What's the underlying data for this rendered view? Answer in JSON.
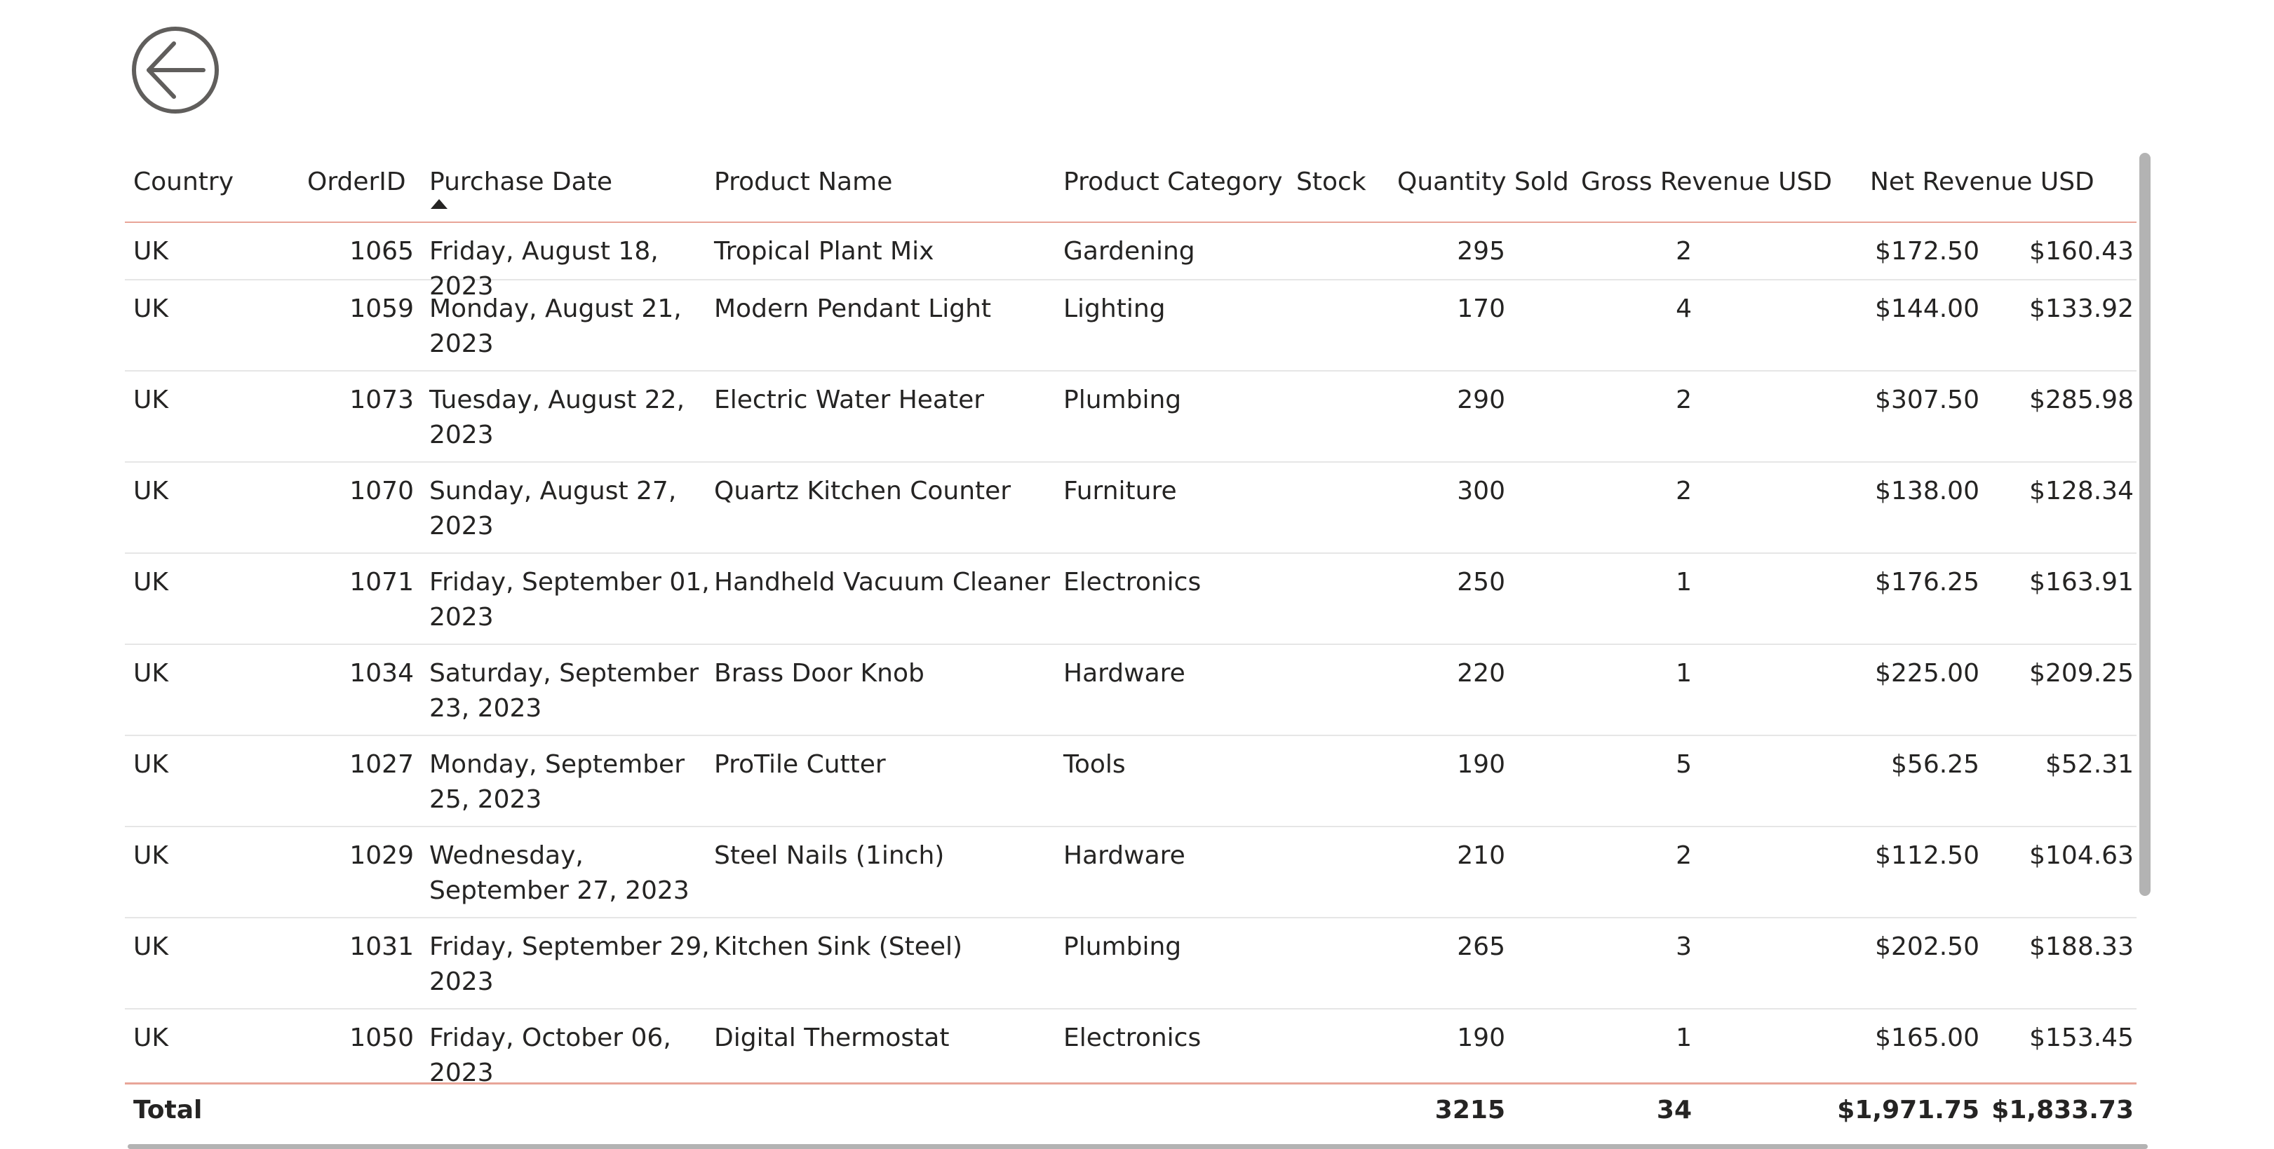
{
  "back_button": {
    "icon": "arrow-left-circle-icon"
  },
  "table": {
    "columns": [
      "Country",
      "OrderID",
      "Purchase Date",
      "Product Name",
      "Product Category",
      "Stock",
      "Quantity Sold",
      "Gross Revenue USD",
      "Net Revenue USD"
    ],
    "sorted_column": "Purchase Date",
    "sort_direction": "ascending",
    "rows": [
      [
        "UK",
        "1065",
        "Friday, August 18, 2023",
        "Tropical Plant Mix",
        "Gardening",
        "295",
        "2",
        "$172.50",
        "$160.43"
      ],
      [
        "UK",
        "1059",
        "Monday, August 21, 2023",
        "Modern Pendant Light",
        "Lighting",
        "170",
        "4",
        "$144.00",
        "$133.92"
      ],
      [
        "UK",
        "1073",
        "Tuesday, August 22, 2023",
        "Electric Water Heater",
        "Plumbing",
        "290",
        "2",
        "$307.50",
        "$285.98"
      ],
      [
        "UK",
        "1070",
        "Sunday, August 27, 2023",
        "Quartz Kitchen Counter",
        "Furniture",
        "300",
        "2",
        "$138.00",
        "$128.34"
      ],
      [
        "UK",
        "1071",
        "Friday, September 01, 2023",
        "Handheld Vacuum Cleaner",
        "Electronics",
        "250",
        "1",
        "$176.25",
        "$163.91"
      ],
      [
        "UK",
        "1034",
        "Saturday, September 23, 2023",
        "Brass Door Knob",
        "Hardware",
        "220",
        "1",
        "$225.00",
        "$209.25"
      ],
      [
        "UK",
        "1027",
        "Monday, September 25, 2023",
        "ProTile Cutter",
        "Tools",
        "190",
        "5",
        "$56.25",
        "$52.31"
      ],
      [
        "UK",
        "1029",
        "Wednesday, September 27, 2023",
        "Steel Nails (1inch)",
        "Hardware",
        "210",
        "2",
        "$112.50",
        "$104.63"
      ],
      [
        "UK",
        "1031",
        "Friday, September 29, 2023",
        "Kitchen Sink (Steel)",
        "Plumbing",
        "265",
        "3",
        "$202.50",
        "$188.33"
      ],
      [
        "UK",
        "1050",
        "Friday, October 06, 2023",
        "Digital Thermostat",
        "Electronics",
        "190",
        "1",
        "$165.00",
        "$153.45"
      ]
    ],
    "total": {
      "label": "Total",
      "stock": "3215",
      "quantity_sold": "34",
      "gross_revenue": "$1,971.75",
      "net_revenue": "$1,833.73"
    }
  },
  "colors": {
    "header_rule": "#e8a598",
    "row_divider": "#e6e6e6",
    "scrollbar": "#b3b3b3",
    "text": "#252423"
  }
}
